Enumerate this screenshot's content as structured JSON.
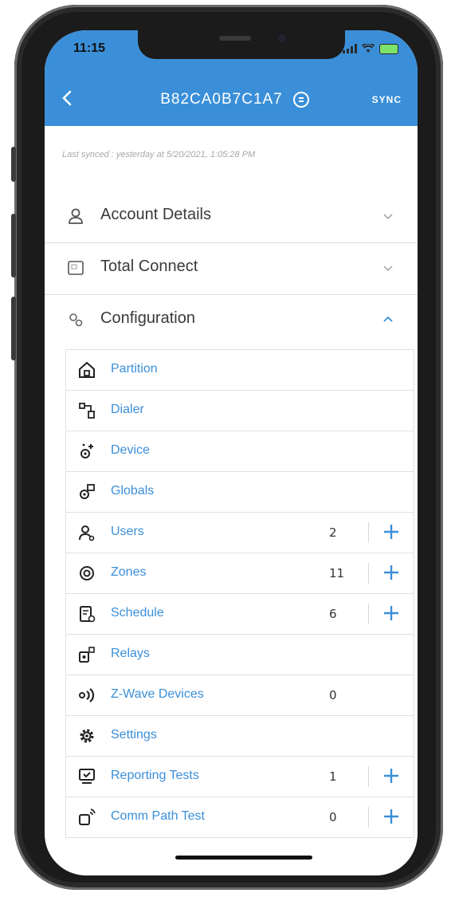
{
  "status_bar": {
    "time": "11:15"
  },
  "header": {
    "title": "B82CA0B7C1A7",
    "sync_label": "SYNC",
    "accent": "#3a8fd8"
  },
  "last_synced": "Last synced : yesterday at 5/20/2021, 1:05:28 PM",
  "sections": [
    {
      "label": "Account Details",
      "icon": "person-icon",
      "expanded": false
    },
    {
      "label": "Total Connect",
      "icon": "panel-icon",
      "expanded": false
    },
    {
      "label": "Configuration",
      "icon": "gears-icon",
      "expanded": true
    }
  ],
  "config_items": [
    {
      "label": "Partition",
      "icon": "house-icon",
      "count": "",
      "add": false
    },
    {
      "label": "Dialer",
      "icon": "dialer-icon",
      "count": "",
      "add": false
    },
    {
      "label": "Device",
      "icon": "device-icon",
      "count": "",
      "add": false
    },
    {
      "label": "Globals",
      "icon": "globals-icon",
      "count": "",
      "add": false
    },
    {
      "label": "Users",
      "icon": "users-icon",
      "count": "2",
      "add": true
    },
    {
      "label": "Zones",
      "icon": "zones-icon",
      "count": "11",
      "add": true
    },
    {
      "label": "Schedule",
      "icon": "schedule-icon",
      "count": "6",
      "add": true
    },
    {
      "label": "Relays",
      "icon": "relays-icon",
      "count": "",
      "add": false
    },
    {
      "label": "Z-Wave Devices",
      "icon": "zwave-icon",
      "count": "0",
      "add": false
    },
    {
      "label": "Settings",
      "icon": "settings-icon",
      "count": "",
      "add": false
    },
    {
      "label": "Reporting Tests",
      "icon": "reporting-icon",
      "count": "1",
      "add": true
    },
    {
      "label": "Comm Path Test",
      "icon": "comm-path-icon",
      "count": "0",
      "add": true
    }
  ]
}
